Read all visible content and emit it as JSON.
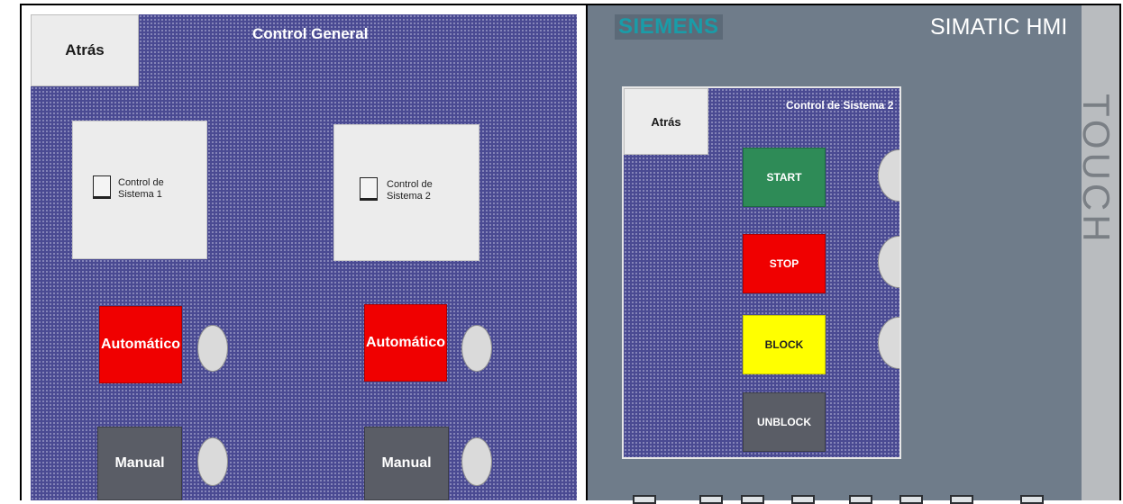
{
  "left": {
    "title": "Control General",
    "back_label": "Atrás",
    "systems": [
      {
        "label_line1": "Control de",
        "label_line2": "Sistema 1"
      },
      {
        "label_line1": "Control de",
        "label_line2": "Sistema 2"
      }
    ],
    "auto_label": "Automático",
    "manual_label": "Manual"
  },
  "right": {
    "brand": "SIEMENS",
    "product": "SIMATIC HMI",
    "side_label": "TOUCH",
    "title": "Control de Sistema 2",
    "back_label": "Atrás",
    "buttons": [
      {
        "label": "START",
        "color": "#2e8b57"
      },
      {
        "label": "STOP",
        "color": "#f00000"
      },
      {
        "label": "BLOCK",
        "color": "#ffff00"
      },
      {
        "label": "UNBLOCK",
        "color": "#5a5d66"
      }
    ],
    "function_key_count": 8
  }
}
